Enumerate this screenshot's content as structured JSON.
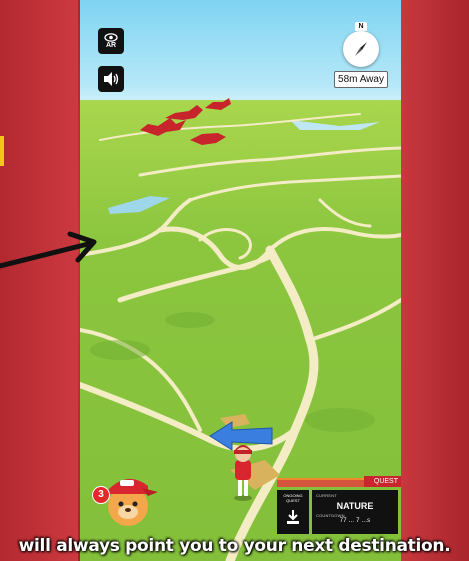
{
  "hud": {
    "ar_label": "AR",
    "compass_north": "N",
    "distance": "58m Away"
  },
  "quest": {
    "header": "QUEST",
    "ongoing_label": "ONGOING QUEST",
    "current_label": "CURRENT",
    "category": "NATURE",
    "countdown_label": "COUNTDOWN",
    "countdown_value": "77 ... 7 ...s"
  },
  "avatar": {
    "notification_count": "3"
  },
  "caption": {
    "text": "will always point you to your next destination."
  },
  "colors": {
    "frame_red": "#c8383e",
    "grass_green": "#8cc63f",
    "path_cream": "#f3ecc4",
    "direction_arrow": "#3a7ee0",
    "quest_red": "#c8252c"
  },
  "icons": [
    "eye-icon",
    "speaker-icon",
    "compass-icon",
    "direction-arrow-icon",
    "download-icon",
    "pointer-arrow-icon"
  ]
}
